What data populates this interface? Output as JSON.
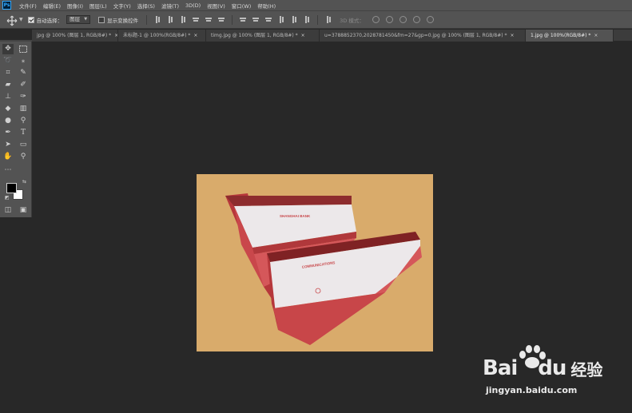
{
  "app": {
    "logo_text": "Ps"
  },
  "menu": [
    "文件(F)",
    "编辑(E)",
    "图像(I)",
    "图层(L)",
    "文字(Y)",
    "选择(S)",
    "滤镜(T)",
    "3D(D)",
    "视图(V)",
    "窗口(W)",
    "帮助(H)"
  ],
  "options": {
    "auto_select_label": "自动选择：",
    "auto_select_value": "图层",
    "show_transform_label": "显示变换控件",
    "mode_3d_label": "3D 模式："
  },
  "tabs": [
    {
      "label": "jpg @ 100% (图层 1, RGB/8#) *",
      "close": "×"
    },
    {
      "label": "未标题-1 @ 100%(RGB/8#) *",
      "close": "×"
    },
    {
      "label": "timg.jpg @ 100% (图层 1, RGB/8#) *",
      "close": "×"
    },
    {
      "label": "u=3788852370,2028781450&fm=27&gp=0.jpg @ 100% (图层 1, RGB/8#) *",
      "close": "×"
    },
    {
      "label": "1.jpg @ 100%(RGB/8#) *",
      "close": "×"
    }
  ],
  "image": {
    "boxes": [
      {
        "lid_text": "SHANGHAI BANK"
      },
      {
        "lid_text": "COMMUNICATIONS"
      }
    ]
  },
  "watermark": {
    "brand_a": "Bai",
    "brand_b": "du",
    "brand_cn": "经验",
    "url": "jingyan.baidu.com"
  },
  "colors": {
    "workspace": "#282828",
    "panel": "#535353",
    "image_background": "#d9ab6b",
    "box_red": "#c8484b",
    "box_white": "#ece8ea"
  }
}
